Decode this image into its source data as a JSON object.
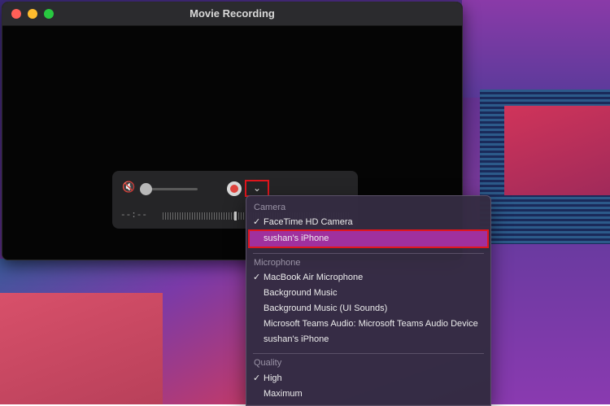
{
  "window": {
    "title": "Movie Recording"
  },
  "controls": {
    "timecode": "--:--",
    "dropdown_glyph": "⌄",
    "mute_glyph": "🔇"
  },
  "menu": {
    "camera_header": "Camera",
    "camera_items": [
      {
        "label": "FaceTime HD Camera",
        "check": "✓"
      },
      {
        "label": "sushan's iPhone",
        "check": ""
      }
    ],
    "microphone_header": "Microphone",
    "microphone_items": [
      {
        "label": "MacBook Air Microphone",
        "check": "✓"
      },
      {
        "label": "Background Music",
        "check": ""
      },
      {
        "label": "Background Music (UI Sounds)",
        "check": ""
      },
      {
        "label": "Microsoft Teams Audio: Microsoft Teams Audio Device",
        "check": ""
      },
      {
        "label": "sushan's iPhone",
        "check": ""
      }
    ],
    "quality_header": "Quality",
    "quality_items": [
      {
        "label": "High",
        "check": "✓"
      },
      {
        "label": "Maximum",
        "check": ""
      }
    ]
  },
  "colors": {
    "highlight": "#a0309e",
    "annotation_red": "#e0161d",
    "record_red": "#e0443e"
  }
}
